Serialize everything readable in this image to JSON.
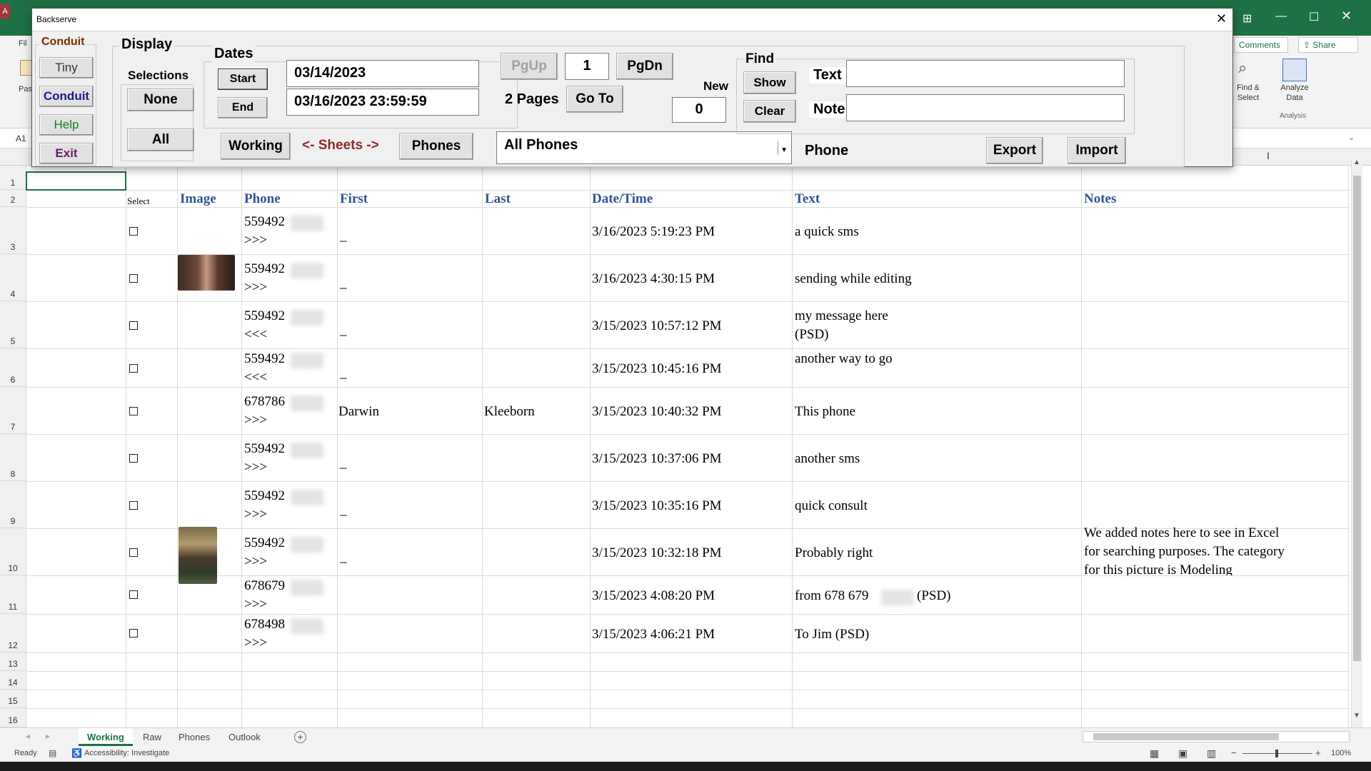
{
  "excel": {
    "app_letter": "A",
    "ribbon": {
      "file_partial": "Fil",
      "paste_partial": "Pas",
      "comments": "Comments",
      "share": "Share",
      "find_select": "Find &\nSelect",
      "analyze_data": "Analyze\nData",
      "analysis_group": "Analysis"
    },
    "name_box": "A1",
    "accent": "#1e7145"
  },
  "dialog": {
    "title": "Backserve",
    "conduit_group": {
      "label": "Conduit",
      "buttons": [
        "Tiny",
        "Conduit",
        "Help",
        "Exit"
      ]
    },
    "display_group": {
      "label": "Display",
      "selections_label": "Selections",
      "none_button": "None",
      "all_button": "All",
      "working_button": "Working",
      "sheets_label": "<- Sheets ->",
      "phones_button": "Phones"
    },
    "dates_group": {
      "label": "Dates",
      "start_button": "Start",
      "end_button": "End",
      "start_value": "03/14/2023",
      "end_value": "03/16/2023 23:59:59"
    },
    "paging": {
      "pgup": "PgUp",
      "page": "1",
      "pgdn": "PgDn",
      "pages_text": "2 Pages",
      "goto": "Go To",
      "new_label": "New",
      "new_value": "0"
    },
    "phone_select": {
      "value": "All Phones"
    },
    "find_group": {
      "label": "Find",
      "show_button": "Show",
      "clear_button": "Clear",
      "text_label": "Text",
      "note_label": "Note",
      "text_value": "",
      "note_value": ""
    },
    "phone_label": "Phone",
    "export_button": "Export",
    "import_button": "Import"
  },
  "sheet": {
    "row_numbers": [
      "1",
      "2",
      "3",
      "4",
      "5",
      "6",
      "7",
      "8",
      "9",
      "10",
      "11",
      "12",
      "13",
      "14",
      "15",
      "16"
    ],
    "headers": {
      "select": "Select",
      "image": "Image",
      "phone": "Phone",
      "first": "First",
      "last": "Last",
      "datetime": "Date/Time",
      "text": "Text",
      "notes": "Notes"
    },
    "rows": [
      {
        "phone": "559492",
        "dir": ">>>",
        "first": "_",
        "last": "",
        "datetime": "3/16/2023 5:19:23 PM",
        "text": "a quick sms",
        "text2": "",
        "notes": []
      },
      {
        "phone": "559492",
        "dir": ">>>",
        "first": "_",
        "last": "",
        "datetime": "3/16/2023 4:30:15 PM",
        "text": "sending while editing",
        "text2": "",
        "notes": []
      },
      {
        "phone": "559492",
        "dir": "<<<",
        "first": "_",
        "last": "",
        "datetime": "3/15/2023 10:57:12 PM",
        "text": "my message here",
        "text2": "(PSD)",
        "notes": []
      },
      {
        "phone": "559492",
        "dir": "<<<",
        "first": "_",
        "last": "",
        "datetime": "3/15/2023 10:45:16 PM",
        "text": "another way to go",
        "text2": "",
        "notes": []
      },
      {
        "phone": "678786",
        "dir": ">>>",
        "first": "Darwin",
        "last": "Kleeborn",
        "datetime": "3/15/2023 10:40:32 PM",
        "text": "This phone",
        "text2": "",
        "notes": []
      },
      {
        "phone": "559492",
        "dir": ">>>",
        "first": "_",
        "last": "",
        "datetime": "3/15/2023 10:37:06 PM",
        "text": "another sms",
        "text2": "",
        "notes": []
      },
      {
        "phone": "559492",
        "dir": ">>>",
        "first": "_",
        "last": "",
        "datetime": "3/15/2023 10:35:16 PM",
        "text": "quick consult",
        "text2": "",
        "notes": []
      },
      {
        "phone": "559492",
        "dir": ">>>",
        "first": "_",
        "last": "",
        "datetime": "3/15/2023 10:32:18 PM",
        "text": "Probably right",
        "text2": "",
        "notes": [
          "We added notes here to see in Excel",
          "for searching purposes. The category",
          "for this picture is Modeling"
        ]
      },
      {
        "phone": "678679",
        "dir": ">>>",
        "first": "",
        "last": "",
        "datetime": "3/15/2023 4:08:20 PM",
        "text": "from 678 679",
        "text2": "(PSD)",
        "notes": []
      },
      {
        "phone": "678498",
        "dir": ">>>",
        "first": "",
        "last": "",
        "datetime": "3/15/2023 4:06:21 PM",
        "text": "To Jim (PSD)",
        "text2": "",
        "notes": []
      }
    ]
  },
  "tabs": [
    "Working",
    "Raw",
    "Phones",
    "Outlook"
  ],
  "status": {
    "ready": "Ready",
    "accessibility": "Accessibility: Investigate",
    "zoom": "100%"
  }
}
